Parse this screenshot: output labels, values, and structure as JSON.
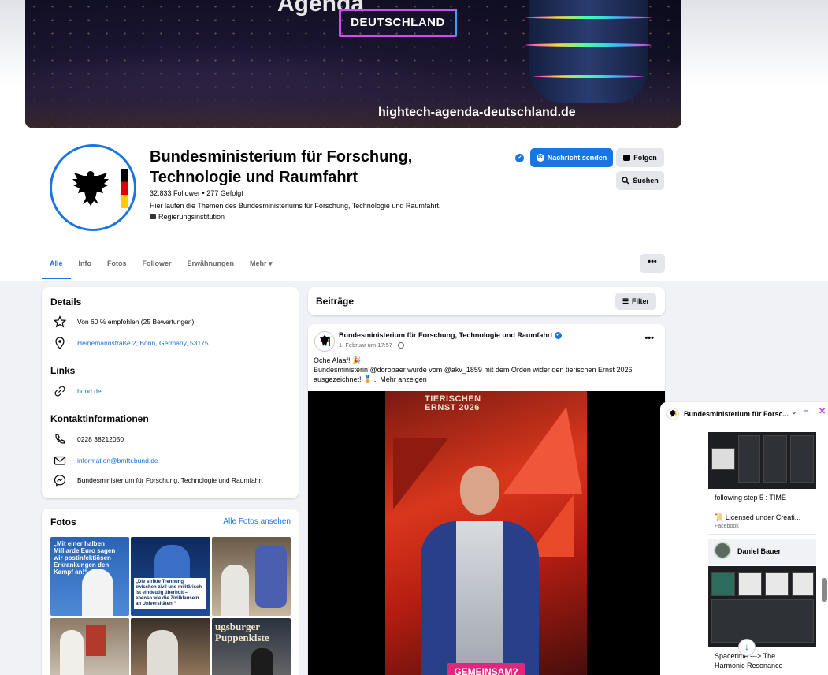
{
  "cover": {
    "brand_word": "Agenda",
    "brand_box": "DEUTSCHLAND",
    "url": "hightech-agenda-deutschland.de"
  },
  "profile": {
    "name": "Bundesministerium für Forschung, Technologie und Raumfahrt",
    "stats": "32.833 Follower • 277 Gefolgt",
    "intro": "Hier laufen die Themen des Bundesministeriums für Forschung, Technologie und Raumfahrt.",
    "category": "Regierungsinstitution",
    "verified_glyph": "✔"
  },
  "actions": {
    "message": "Nachricht senden",
    "follow": "Folgen",
    "search": "Suchen",
    "more": "•••"
  },
  "tabs": [
    {
      "label": "Alle"
    },
    {
      "label": "Info"
    },
    {
      "label": "Fotos"
    },
    {
      "label": "Follower"
    },
    {
      "label": "Erwähnungen"
    },
    {
      "label": "Mehr ▾"
    }
  ],
  "details": {
    "title": "Details",
    "recommend": "Von 60 % empfohlen (25 Bewertungen)",
    "address": "Heinemannstraße 2, Bonn, Germany, 53175",
    "links_title": "Links",
    "website": "bund.de",
    "contact_title": "Kontaktinformationen",
    "phone": "0228 38212050",
    "email": "information@bmftr.bund.de",
    "messenger": "Bundesministerium für Forschung, Technologie und Raumfahrt"
  },
  "photos": {
    "title": "Fotos",
    "all_link": "Alle Fotos ansehen",
    "p1_text": "„Mit einer halben Milliarde Euro sagen wir postinfektiösen Erkrankungen den Kampf an!“",
    "p2_text": "„Die strikte Trennung zwischen zivil und militärisch ist eindeutig überholt – ebenso wie die Zivilklauseln an Universitäten.“",
    "p5_text": "ugsburger Puppenkiste"
  },
  "feed": {
    "title": "Beiträge",
    "filter": "Filter"
  },
  "post": {
    "author": "Bundesministerium für Forschung, Technologie und Raumfahrt",
    "date": "1. Februar um 17:57 · ",
    "line1": "Oche Alaaf! 🎉",
    "line2": "Bundesministerin @dorobaer wurde vom @akv_1859 mit dem Orden wider den tierischen Ernst 2026 ausgezeichnet! 🏅... Mehr anzeigen",
    "sign": "TIERISCHEN ERNST 2026",
    "banner": "GEMEINSAM?",
    "menu": "•••"
  },
  "chat": {
    "title": "Bundesministerium für Forsc...",
    "item1_title": "following step 5 : TIME",
    "item1_sub": "📜 Licensed under Creati...",
    "item1_source": "Facebook",
    "item2_user": "Daniel Bauer",
    "item2_title": "Spacetime ---> The Harmonic Resonance"
  },
  "colors": {
    "accent": "#1b74e4",
    "messenger_purple": "#c13cf0"
  }
}
